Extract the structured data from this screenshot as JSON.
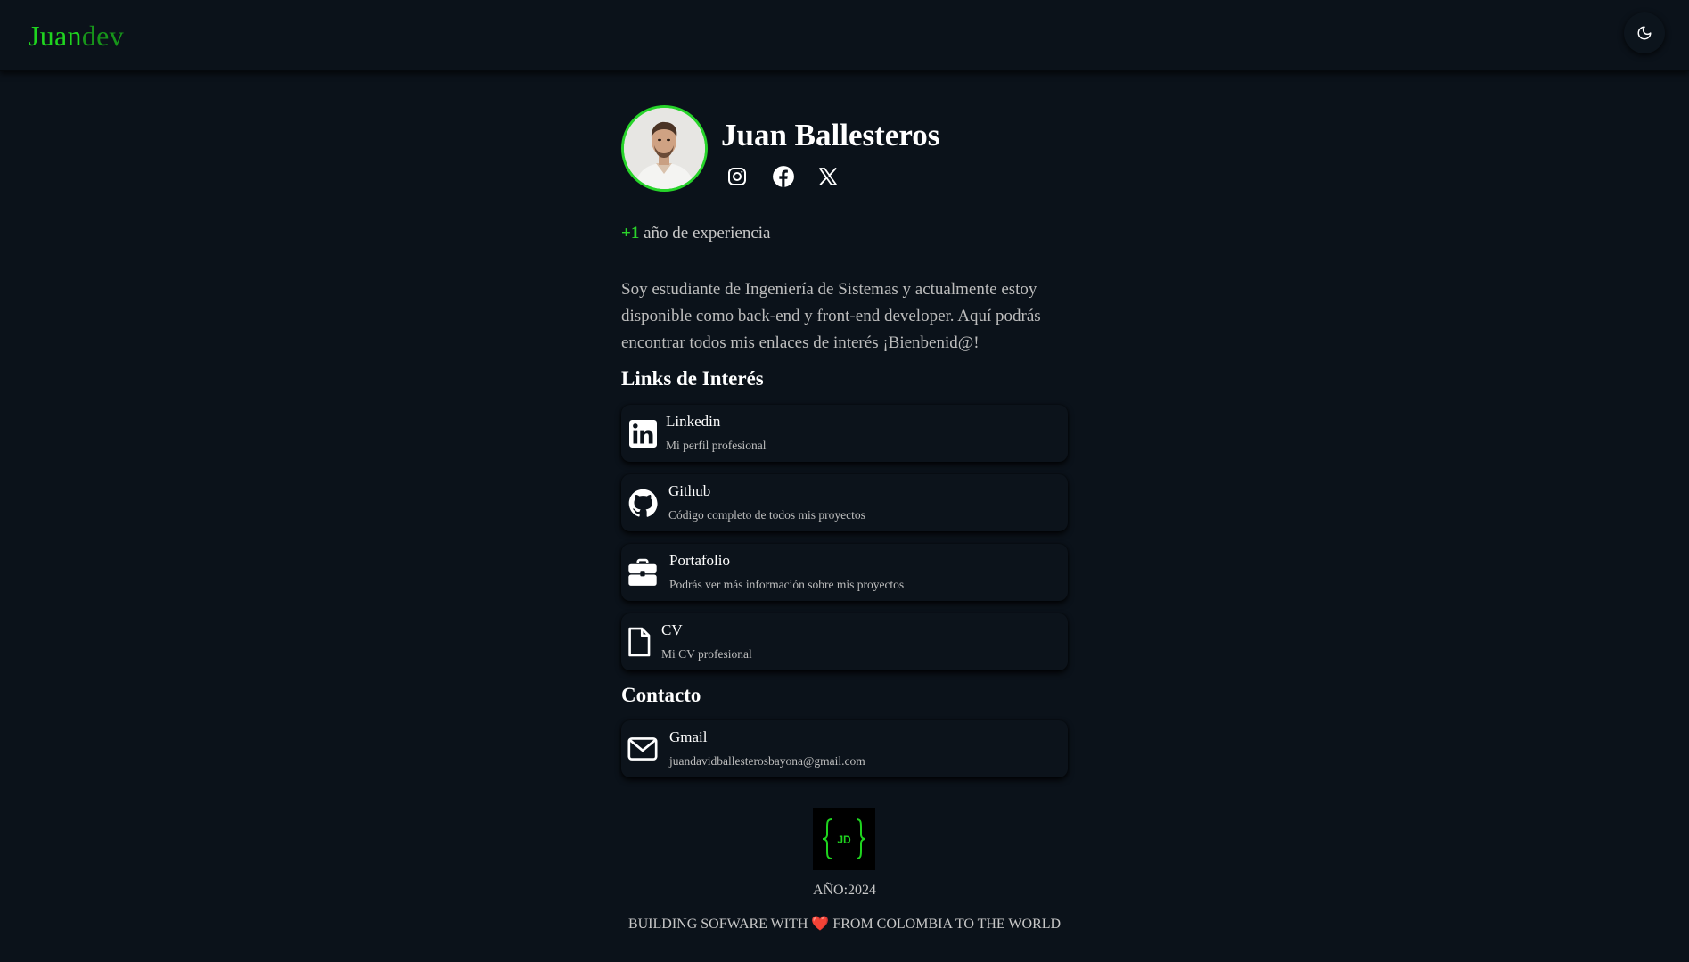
{
  "header": {
    "logo_part1": "Juan",
    "logo_part2": "dev",
    "theme_toggle_icon": "moon-icon"
  },
  "profile": {
    "name": "Juan Ballesteros",
    "avatar_icon": "profile-photo",
    "socials": [
      {
        "icon": "instagram-icon"
      },
      {
        "icon": "facebook-icon"
      },
      {
        "icon": "x-icon"
      }
    ],
    "experience_prefix": "+1",
    "experience_text": " año de experiencia",
    "bio": "Soy estudiante de Ingeniería de Sistemas y actualmente estoy disponible como back-end y front-end developer. Aquí podrás encontrar todos mis enlaces de interés ¡Bienbenid@!"
  },
  "links": {
    "title": "Links de Interés",
    "items": [
      {
        "title": "Linkedin",
        "desc": "Mi perfil profesional",
        "icon": "linkedin-icon"
      },
      {
        "title": "Github",
        "desc": "Código completo de todos mis proyectos",
        "icon": "github-icon"
      },
      {
        "title": "Portafolio",
        "desc": "Podrás ver más información sobre mis proyectos",
        "icon": "briefcase-icon"
      },
      {
        "title": "CV",
        "desc": "Mi CV profesional",
        "icon": "file-icon"
      }
    ]
  },
  "contact": {
    "title": "Contacto",
    "items": [
      {
        "title": "Gmail",
        "desc": "juandavidballesterosbayona@gmail.com",
        "icon": "envelope-icon"
      }
    ]
  },
  "footer": {
    "logo_text": "JD",
    "year_text": "AÑO:2024",
    "tagline_before": "BUILDING SOFWARE WITH ",
    "heart": "❤️",
    "tagline_after": " FROM COLOMBIA TO THE WORLD"
  },
  "colors": {
    "background": "#0b121a",
    "accent_green": "#1fd41f",
    "accent_green_dark": "#17961a",
    "text": "#e6e6e6"
  }
}
